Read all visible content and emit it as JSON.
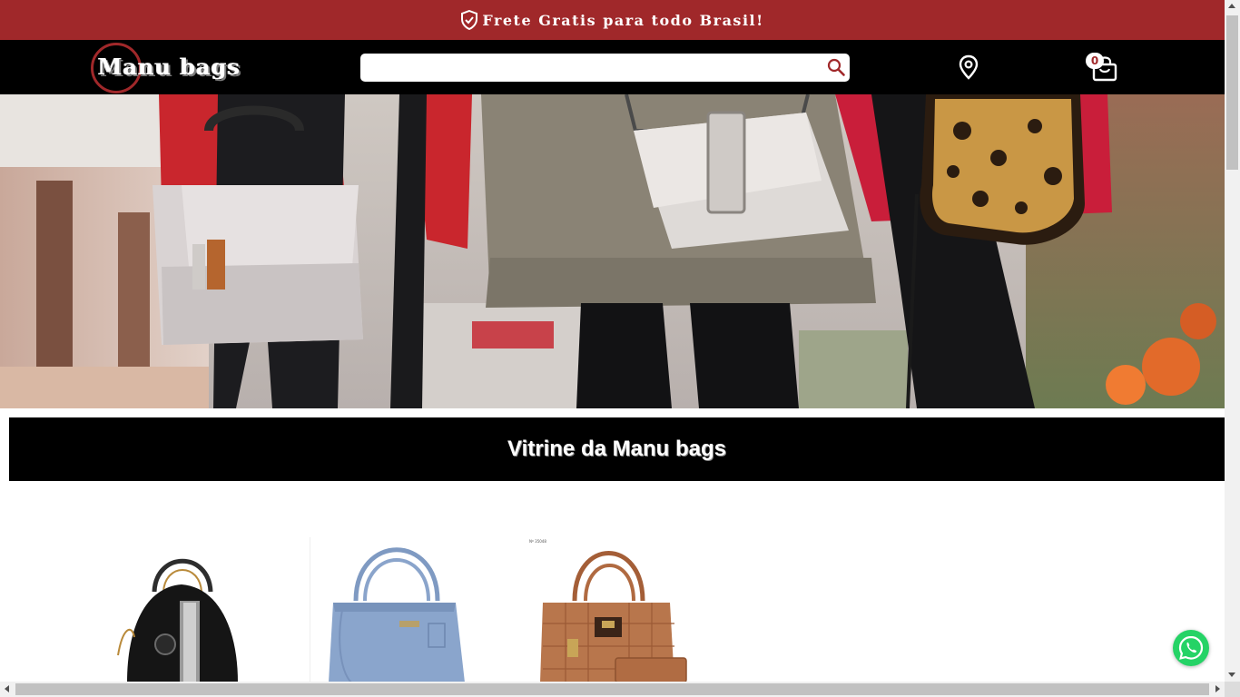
{
  "promo": {
    "text": "Frete Gratis para todo Brasil!",
    "icon": "shield-check-icon"
  },
  "header": {
    "logo_text": "Manu bags",
    "search": {
      "value": "",
      "placeholder": ""
    },
    "search_icon": "search-icon",
    "location_icon": "location-pin-icon",
    "cart": {
      "icon": "shopping-bag-icon",
      "count": "0"
    }
  },
  "hero": {
    "alt": "Three women holding handbags"
  },
  "showcase": {
    "title": "Vitrine da Manu bags",
    "products": [
      {
        "kind": "black handbag"
      },
      {
        "kind": "light blue handbag"
      },
      {
        "kind": "caramel quilted handbag with wallet",
        "code": "Nº 35048"
      }
    ]
  },
  "whatsapp": {
    "icon": "whatsapp-icon"
  },
  "colors": {
    "brand_red": "#a0282a",
    "header_bg": "#000000",
    "whatsapp_green": "#25d366"
  }
}
